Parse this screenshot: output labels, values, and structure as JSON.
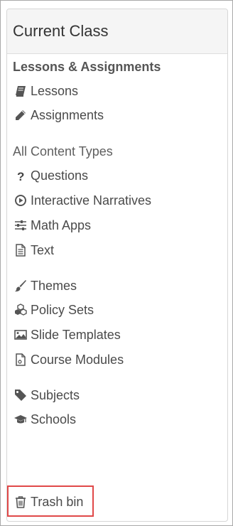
{
  "panel": {
    "header": "Current Class"
  },
  "sections": {
    "lessons_heading": "Lessons & Assignments",
    "content_types_heading": "All Content Types"
  },
  "items": {
    "lessons": "Lessons",
    "assignments": "Assignments",
    "questions": "Questions",
    "interactive_narratives": "Interactive Narratives",
    "math_apps": "Math Apps",
    "text": "Text",
    "themes": "Themes",
    "policy_sets": "Policy Sets",
    "slide_templates": "Slide Templates",
    "course_modules": "Course Modules",
    "subjects": "Subjects",
    "schools": "Schools",
    "trash_bin": "Trash bin"
  },
  "colors": {
    "highlight_border": "#e04848",
    "icon": "#555555"
  }
}
